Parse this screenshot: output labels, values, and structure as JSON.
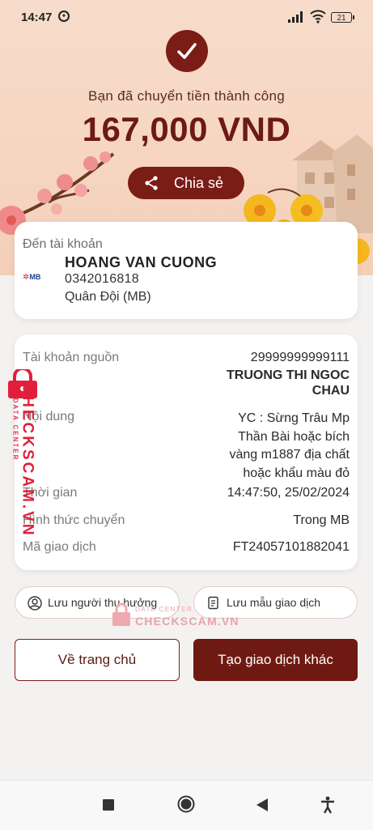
{
  "status_bar": {
    "time": "14:47",
    "battery": "21"
  },
  "hero": {
    "success_text": "Bạn đã chuyển tiền thành công",
    "amount": "167,000 VND",
    "share_label": "Chia sẻ"
  },
  "recipient": {
    "label": "Đến tài khoản",
    "bank_logo": "MB",
    "name": "HOANG VAN CUONG",
    "account": "0342016818",
    "bank": "Quân Đội (MB)"
  },
  "details": {
    "source_label": "Tài khoản nguồn",
    "source_account": "29999999999111",
    "source_name_1": "TRUONG THI NGOC",
    "source_name_2": "CHAU",
    "content_label": "Nội dung",
    "content_lines": [
      "YC : Sừng Trâu Mp",
      "Thần Bài hoặc bích",
      "vàng  m1887 địa chất",
      "hoặc khẩu màu đỏ"
    ],
    "time_label": "Thời gian",
    "time_value": "14:47:50, 25/02/2024",
    "method_label": "Hình thức chuyển",
    "method_value": "Trong MB",
    "code_label": "Mã giao dịch",
    "code_value": "FT24057101882041"
  },
  "actions": {
    "save_recipient": "Lưu người thụ hưởng",
    "save_template": "Lưu mẫu giao dịch",
    "home": "Về trang chủ",
    "new_transaction": "Tạo giao dịch khác"
  },
  "watermark": {
    "brand": "CHECKSCAM.VN",
    "sub": "DATA CENTER"
  },
  "colors": {
    "brand_dark": "#7a1d16",
    "hero_bg": "#f6d6c2",
    "watermark": "#e0203a"
  }
}
